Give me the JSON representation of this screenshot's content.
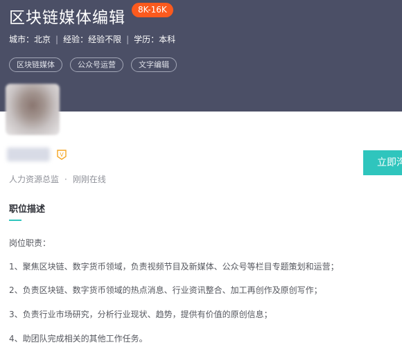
{
  "job": {
    "title": "区块链媒体编辑",
    "salary": "8K-16K",
    "meta": {
      "city_label": "城市：",
      "city": "北京",
      "experience_label": "经验：",
      "experience": "经验不限",
      "education_label": "学历：",
      "education": "本科"
    },
    "tags": [
      "区块链媒体",
      "公众号运营",
      "文字编辑"
    ]
  },
  "recruiter": {
    "title": "人力资源总监",
    "status": "刚刚在线",
    "badge": "V"
  },
  "apply_button": "立即沟通",
  "description": {
    "heading": "职位描述",
    "intro": "岗位职责：",
    "items": [
      "1、聚焦区块链、数字货币领域，负责视频节目及新媒体、公众号等栏目专题策划和运营；",
      "2、负责区块链、数字货币领域的热点消息、行业资讯整合、加工再创作及原创写作；",
      "3、负责行业市场研究，分析行业现状、趋势，提供有价值的原创信息；",
      "4、助团队完成相关的其他工作任务。"
    ]
  },
  "colors": {
    "header_bg": "#4b4f66",
    "salary_bg": "#fb5a1e",
    "accent": "#2fc5bd",
    "badge": "#f5a623"
  }
}
